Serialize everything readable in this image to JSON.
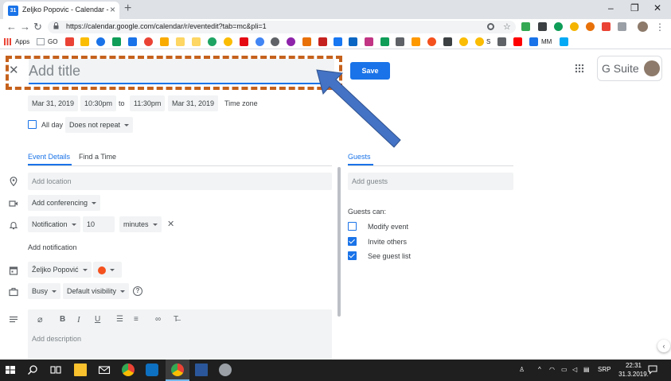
{
  "browser": {
    "tab_title": "Zeljko Popovic - Calendar - Event",
    "tab_favicon_text": "31",
    "url": "https://calendar.google.com/calendar/r/eventedit?tab=mc&pli=1",
    "bookmark_apps_label": "Apps",
    "bookmark_go_label": "GO",
    "bookmark_s_label": "S",
    "bookmark_mm_label": "MM"
  },
  "header": {
    "title_placeholder": "Add title",
    "save_label": "Save",
    "gsuite_label": "G Suite"
  },
  "datetime": {
    "start_date": "Mar 31, 2019",
    "start_time": "10:30pm",
    "to_label": "to",
    "end_time": "11:30pm",
    "end_date": "Mar 31, 2019",
    "timezone_label": "Time zone",
    "allday_label": "All day",
    "repeat_label": "Does not repeat"
  },
  "tabs": {
    "event_details": "Event Details",
    "find_time": "Find a Time"
  },
  "details": {
    "location_placeholder": "Add location",
    "conferencing_label": "Add conferencing",
    "notification_type": "Notification",
    "notification_value": "10",
    "notification_unit": "minutes",
    "add_notification": "Add notification",
    "calendar_owner": "Željko Popović",
    "busy_label": "Busy",
    "visibility_label": "Default visibility",
    "description_placeholder": "Add description"
  },
  "guests": {
    "section_label": "Guests",
    "add_placeholder": "Add guests",
    "can_label": "Guests can:",
    "permissions": [
      {
        "label": "Modify event",
        "checked": false
      },
      {
        "label": "Invite others",
        "checked": true
      },
      {
        "label": "See guest list",
        "checked": true
      }
    ]
  },
  "taskbar": {
    "lang": "SRP",
    "time": "22:31",
    "date": "31.3.2019."
  },
  "colors": {
    "accent": "#1a73e8",
    "highlight": "#c5611c",
    "arrow": "#4472c4",
    "calendar_color": "#f4511e"
  },
  "icons": [
    "close-icon",
    "apps-grid-icon",
    "location-icon",
    "video-icon",
    "bell-icon",
    "calendar-icon",
    "briefcase-icon",
    "help-icon",
    "description-icon",
    "attach-icon",
    "bold-icon",
    "italic-icon",
    "underline-icon",
    "numbered-list-icon",
    "bullet-list-icon",
    "link-icon",
    "clear-format-icon"
  ]
}
